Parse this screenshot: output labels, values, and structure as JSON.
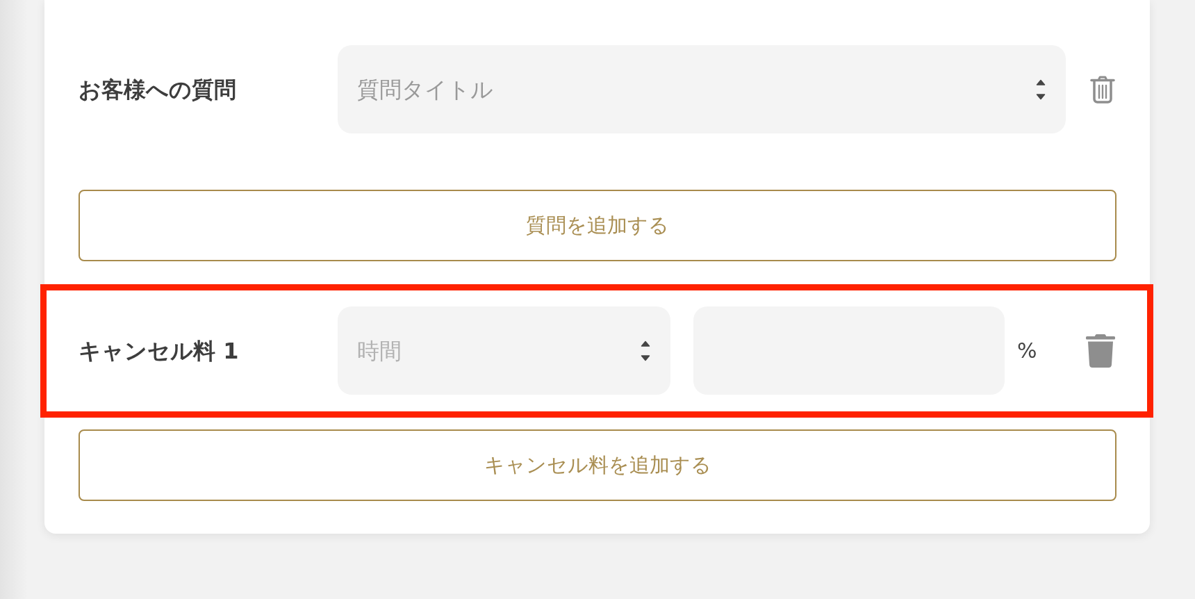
{
  "question_rows": [
    {
      "label": "お客様への質問",
      "select": {
        "placeholder": "質問タイトル"
      }
    }
  ],
  "add_question_button": "質問を追加する",
  "cancel_fee_rows": [
    {
      "label": "キャンセル料 1",
      "highlighted": true,
      "time_select": {
        "placeholder": "時間"
      },
      "unit": "%"
    }
  ],
  "add_cancel_fee_button": "キャンセル料を追加する"
}
